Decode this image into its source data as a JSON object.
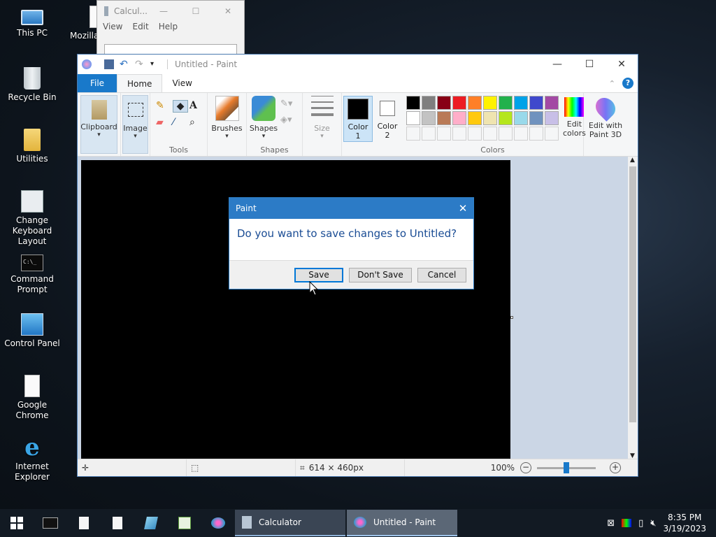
{
  "desktop": {
    "icons": [
      {
        "label": "This PC"
      },
      {
        "label": "Mozilla"
      },
      {
        "label": "Recycle Bin"
      },
      {
        "label": "Utilities"
      },
      {
        "label": "Change Keyboard Layout"
      },
      {
        "label": "Command Prompt"
      },
      {
        "label": "Control Panel"
      },
      {
        "label": "Google Chrome"
      },
      {
        "label": "Internet Explorer"
      }
    ]
  },
  "calculator": {
    "title": "Calcul...",
    "menu": [
      "View",
      "Edit",
      "Help"
    ]
  },
  "paint": {
    "title": "Untitled - Paint",
    "tabs": {
      "file": "File",
      "home": "Home",
      "view": "View"
    },
    "ribbon": {
      "clipboard": "Clipboard",
      "image": "Image",
      "tools": "Tools",
      "brushes": "Brushes",
      "shapes_btn": "Shapes",
      "shapes_group": "Shapes",
      "size": "Size",
      "color1_a": "Color",
      "color1_b": "1",
      "color2_a": "Color",
      "color2_b": "2",
      "colors_group": "Colors",
      "edit_colors_a": "Edit",
      "edit_colors_b": "colors",
      "paint3d_a": "Edit with",
      "paint3d_b": "Paint 3D"
    },
    "palette_row1": [
      "#000000",
      "#7f7f7f",
      "#880015",
      "#ed1c24",
      "#ff7f27",
      "#fff200",
      "#22b14c",
      "#00a2e8",
      "#3f48cc",
      "#a349a4"
    ],
    "palette_row2": [
      "#ffffff",
      "#c3c3c3",
      "#b97a57",
      "#ffaec9",
      "#ffc90e",
      "#efe4b0",
      "#b5e61d",
      "#99d9ea",
      "#7092be",
      "#c8bfe7"
    ],
    "status": {
      "canvas_size": "614 × 460px",
      "zoom": "100%"
    }
  },
  "dialog": {
    "title": "Paint",
    "message": "Do you want to save changes to Untitled?",
    "save": "Save",
    "dont_save": "Don't Save",
    "cancel": "Cancel"
  },
  "taskbar": {
    "apps": [
      {
        "label": "Calculator"
      },
      {
        "label": "Untitled - Paint"
      }
    ],
    "time": "8:35 PM",
    "date": "3/19/2023"
  }
}
